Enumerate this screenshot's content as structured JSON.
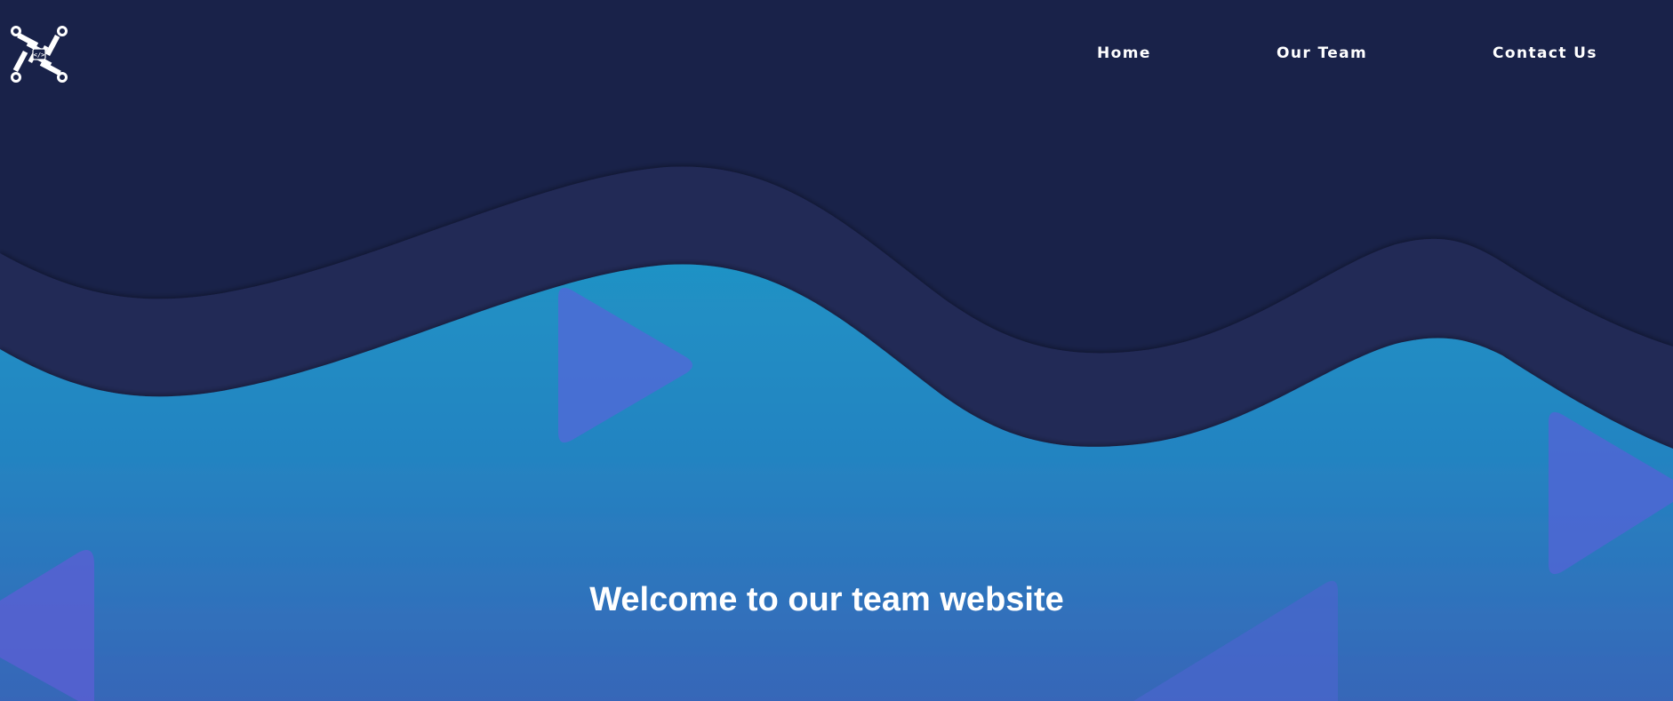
{
  "nav": {
    "home_label": "Home",
    "team_label": "Our Team",
    "contact_label": "Contact Us"
  },
  "logo": {
    "icon": "circuit-code-logo-icon",
    "glyph": "</>"
  },
  "hero": {
    "title": "Welcome to our team website"
  },
  "colors": {
    "background_dark": "#192249",
    "wave_mid": "#232a57",
    "hero_blue_top": "#208fc6",
    "hero_blue_bottom": "#356ab8",
    "triangle": "#5060d0",
    "text": "#ffffff"
  }
}
